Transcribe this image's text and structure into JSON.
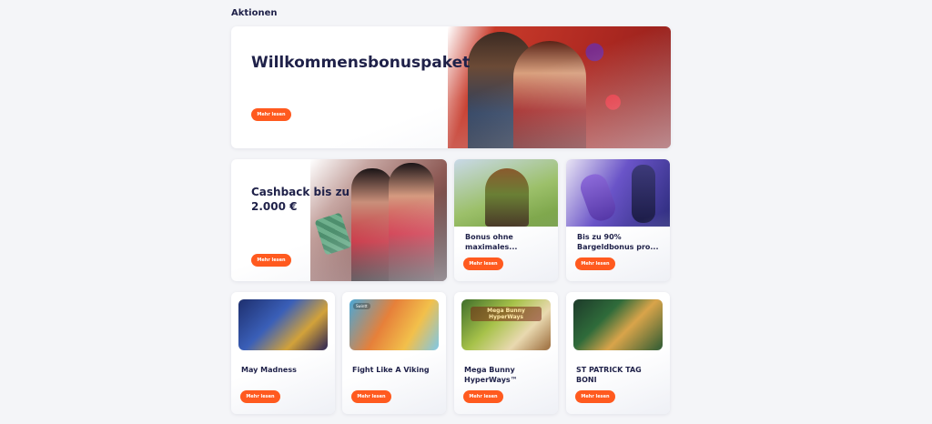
{
  "section": {
    "title": "Aktionen"
  },
  "button_label": "Mehr lesen",
  "hero": {
    "title": "Willkommensbonuspaket",
    "button": "Mehr lesen"
  },
  "cashback": {
    "title": "Cashback bis zu 2.000 €",
    "button": "Mehr lesen"
  },
  "promos": [
    {
      "title": "Bonus ohne maximales...",
      "button": "Mehr lesen"
    },
    {
      "title": "Bis zu 90% Bargeldbonus pro...",
      "button": "Mehr lesen"
    }
  ],
  "games": [
    {
      "title": "May Madness",
      "button": "Mehr lesen"
    },
    {
      "title": "Fight Like A Viking",
      "button": "Mehr lesen",
      "badge": "Swintt"
    },
    {
      "title": "Mega Bunny HyperWays™",
      "button": "Mehr lesen",
      "logo": "Mega Bunny HyperWays"
    },
    {
      "title": "ST PATRICK TAG BONI",
      "button": "Mehr lesen"
    }
  ],
  "colors": {
    "accent": "#ff5a1f",
    "title": "#1f2149",
    "background": "#f4f5f8"
  },
  "icons": [
    "grapes-icon",
    "cherries-icon"
  ]
}
